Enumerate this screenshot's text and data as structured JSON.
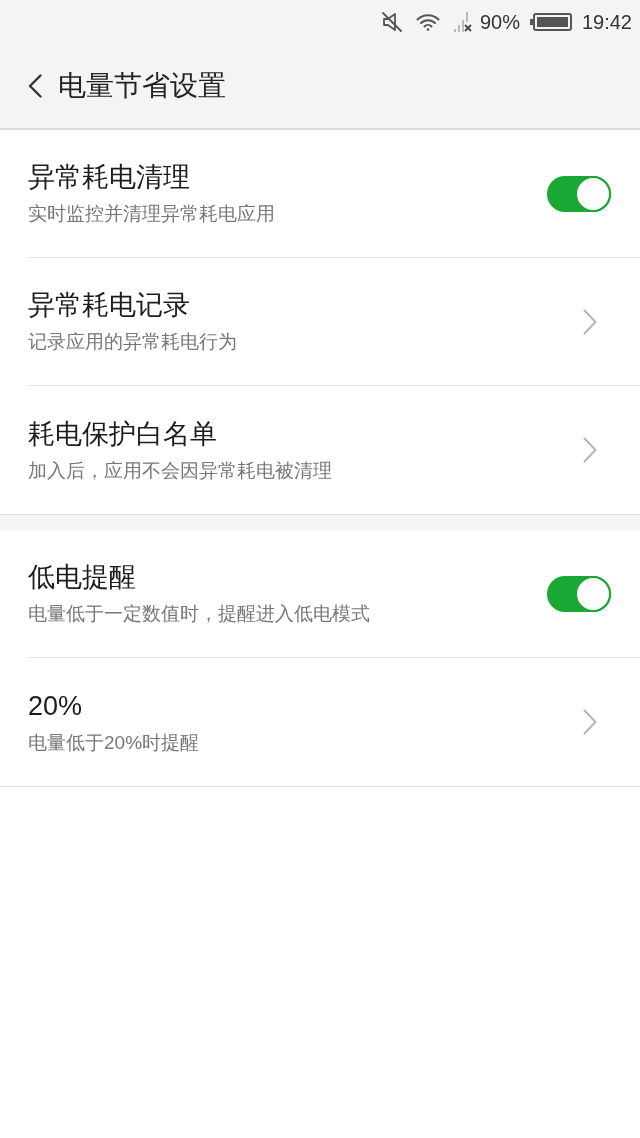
{
  "status_bar": {
    "battery": "90%",
    "time": "19:42"
  },
  "header": {
    "title": "电量节省设置"
  },
  "sections": [
    {
      "rows": [
        {
          "kind": "switch",
          "title": "异常耗电清理",
          "subtitle": "实时监控并清理异常耗电应用",
          "on": true
        },
        {
          "kind": "link",
          "title": "异常耗电记录",
          "subtitle": "记录应用的异常耗电行为"
        },
        {
          "kind": "link",
          "title": "耗电保护白名单",
          "subtitle": "加入后，应用不会因异常耗电被清理"
        }
      ]
    },
    {
      "rows": [
        {
          "kind": "switch",
          "title": "低电提醒",
          "subtitle": "电量低于一定数值时，提醒进入低电模式",
          "on": true
        },
        {
          "kind": "link",
          "title": "20%",
          "subtitle": "电量低于20%时提醒"
        }
      ]
    }
  ]
}
